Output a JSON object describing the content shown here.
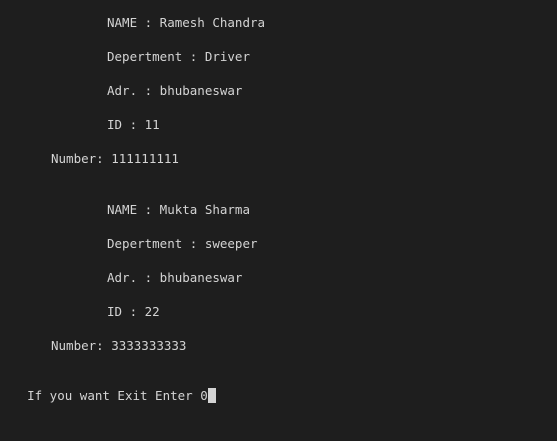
{
  "records": [
    {
      "name": "NAME : Ramesh Chandra",
      "department": "Depertment : Driver",
      "address": "Adr. : bhubaneswar",
      "id": "ID : 11",
      "number": "Number: 111111111"
    },
    {
      "name": "NAME : Mukta Sharma",
      "department": "Depertment : sweeper",
      "address": "Adr. : bhubaneswar",
      "id": "ID : 22",
      "number": "Number: 3333333333"
    }
  ],
  "prompt": {
    "text": "If you want Exit Enter 0",
    "cursor_char": ""
  },
  "colors": {
    "background": "#1e1e1e",
    "text": "#d4d4d4"
  }
}
